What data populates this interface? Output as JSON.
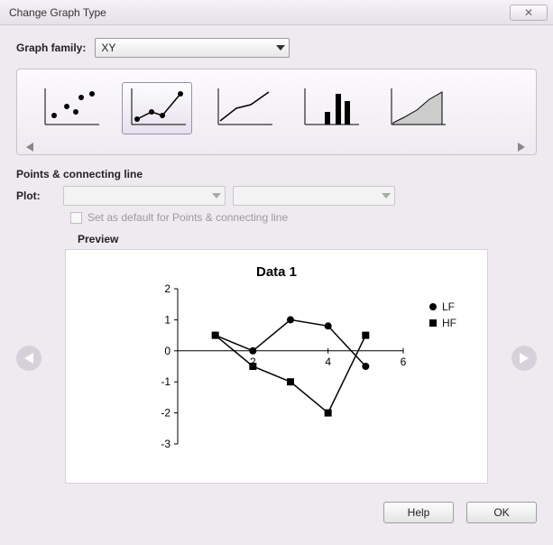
{
  "window": {
    "title": "Change Graph Type",
    "close_glyph": "✕"
  },
  "family": {
    "label": "Graph family:",
    "value": "XY"
  },
  "thumbs": {
    "types": [
      "scatter",
      "points-line",
      "line",
      "column",
      "area"
    ],
    "selected_index": 1
  },
  "section": {
    "title": "Points & connecting line"
  },
  "plot": {
    "label": "Plot:",
    "combo1": "",
    "combo2": ""
  },
  "default_check": {
    "label": "Set as default for Points & connecting line",
    "checked": false
  },
  "preview": {
    "label": "Preview"
  },
  "buttons": {
    "help": "Help",
    "ok": "OK"
  },
  "chart_data": {
    "type": "line",
    "title": "Data 1",
    "xlabel": "",
    "ylabel": "",
    "xlim": [
      0,
      6
    ],
    "ylim": [
      -3,
      2
    ],
    "xticks": [
      0,
      2,
      4,
      6
    ],
    "yticks": [
      -3,
      -2,
      -1,
      0,
      1,
      2
    ],
    "x": [
      1,
      2,
      3,
      4,
      5
    ],
    "series": [
      {
        "name": "LF",
        "marker": "circle",
        "values": [
          0.5,
          0.0,
          1.0,
          0.8,
          -0.5
        ]
      },
      {
        "name": "HF",
        "marker": "square",
        "values": [
          0.5,
          -0.5,
          -1.0,
          -2.0,
          0.5
        ]
      }
    ],
    "legend_position": "right"
  }
}
